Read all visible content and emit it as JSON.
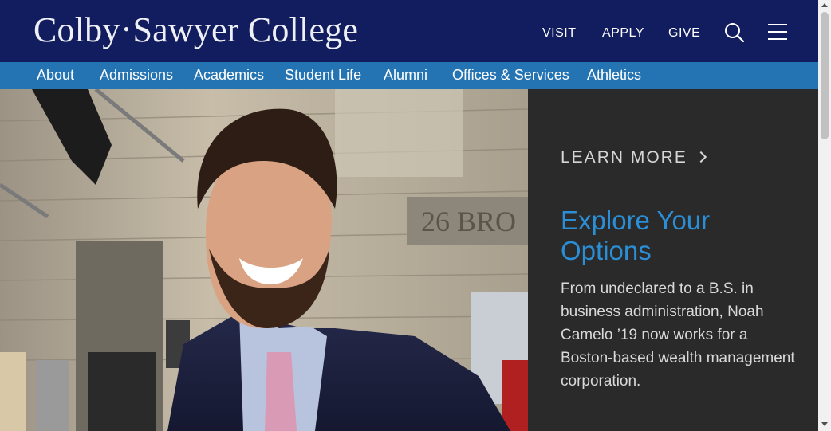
{
  "header": {
    "logo_left": "Colby",
    "logo_dot": "•",
    "logo_right": "Sawyer College",
    "utility_links": [
      "VISIT",
      "APPLY",
      "GIVE"
    ]
  },
  "nav": {
    "items": [
      "About",
      "Admissions",
      "Academics",
      "Student Life",
      "Alumni",
      "Offices & Services",
      "Athletics"
    ]
  },
  "hero": {
    "cta": "LEARN MORE",
    "headline": "Explore Your Options",
    "body": "From undeclared to a B.S. in business administration, Noah Camelo ’19 now works for a Boston-based wealth management corporation.",
    "building_number": "26 BRO"
  },
  "colors": {
    "header_bg": "#111d5e",
    "nav_bg": "#2474b3",
    "panel_bg": "#2a2a2a",
    "headline": "#2a8fd6"
  }
}
